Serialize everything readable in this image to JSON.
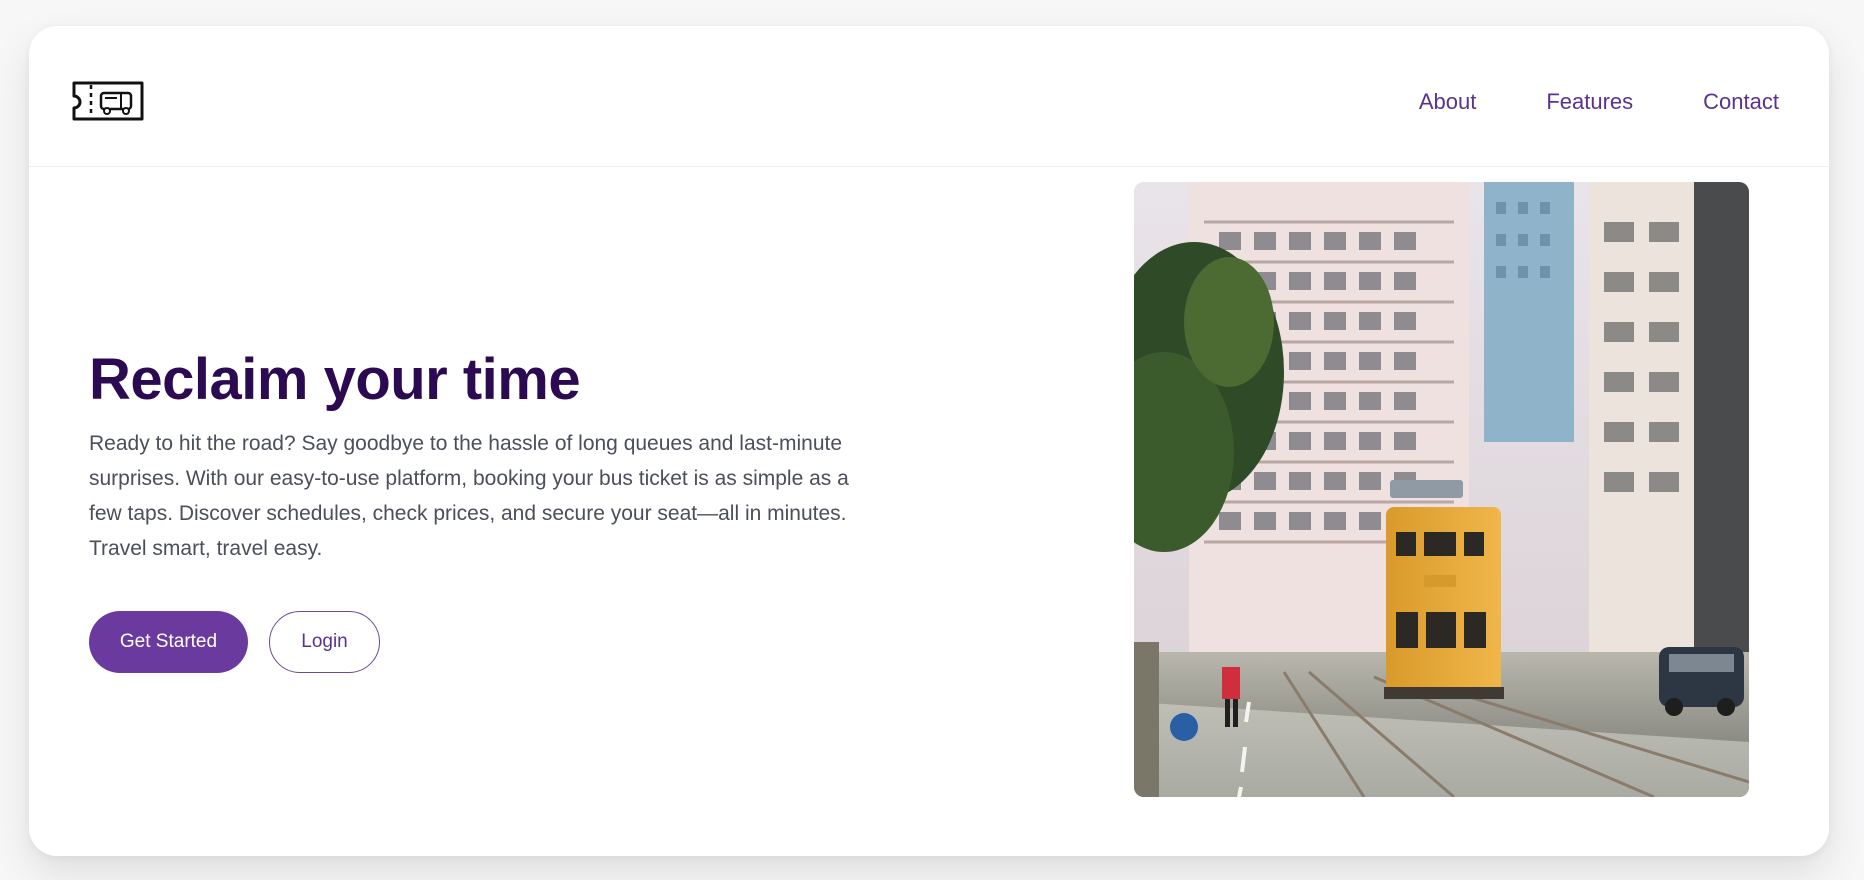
{
  "header": {
    "logo_icon": "bus-ticket-icon",
    "nav": [
      {
        "label": "About"
      },
      {
        "label": "Features"
      },
      {
        "label": "Contact"
      }
    ]
  },
  "hero": {
    "title": "Reclaim your time",
    "description": "Ready to hit the road? Say goodbye to the hassle of long queues and last-minute surprises. With our easy-to-use platform, booking your bus ticket is as simple as a few taps. Discover schedules, check prices, and secure your seat—all in minutes. Travel smart, travel easy.",
    "primary_button": "Get Started",
    "secondary_button": "Login",
    "image_icon": "city-tram-photo"
  },
  "colors": {
    "page_background": "#f7f7f8",
    "card_background": "#ffffff",
    "nav_text": "#5a3290",
    "title_text": "#2b0a52",
    "body_text": "#4b4f5a",
    "primary_button": "#6b3a9f"
  }
}
